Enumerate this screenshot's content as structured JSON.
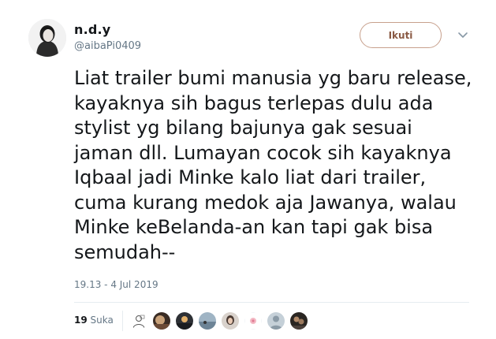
{
  "author": {
    "display_name": "n.d.y",
    "username": "@aibaPi0409"
  },
  "follow_button": {
    "label": "Ikuti"
  },
  "tweet": {
    "lines": [
      "Liat trailer bumi manusia yg baru release,",
      "kayaknya sih bagus terlepas dulu ada",
      "stylist yg bilang bajunya gak sesuai",
      "jaman dll. Lumayan cocok sih kayaknya",
      "Iqbaal jadi Minke kalo liat dari trailer,",
      "cuma kurang medok aja Jawanya, walau",
      "Minke keBelanda-an kan tapi gak bisa",
      "semudah--"
    ],
    "timestamp": "19.13 - 4 Jul 2019"
  },
  "stats": {
    "likes_count": "19",
    "likes_label": "Suka"
  },
  "colors": {
    "follow_border": "#c7a08c",
    "follow_text": "#8a5a44",
    "secondary_text": "#657786",
    "divider": "#e6ecf0"
  },
  "icons": {
    "more": "chevron-down-icon"
  }
}
